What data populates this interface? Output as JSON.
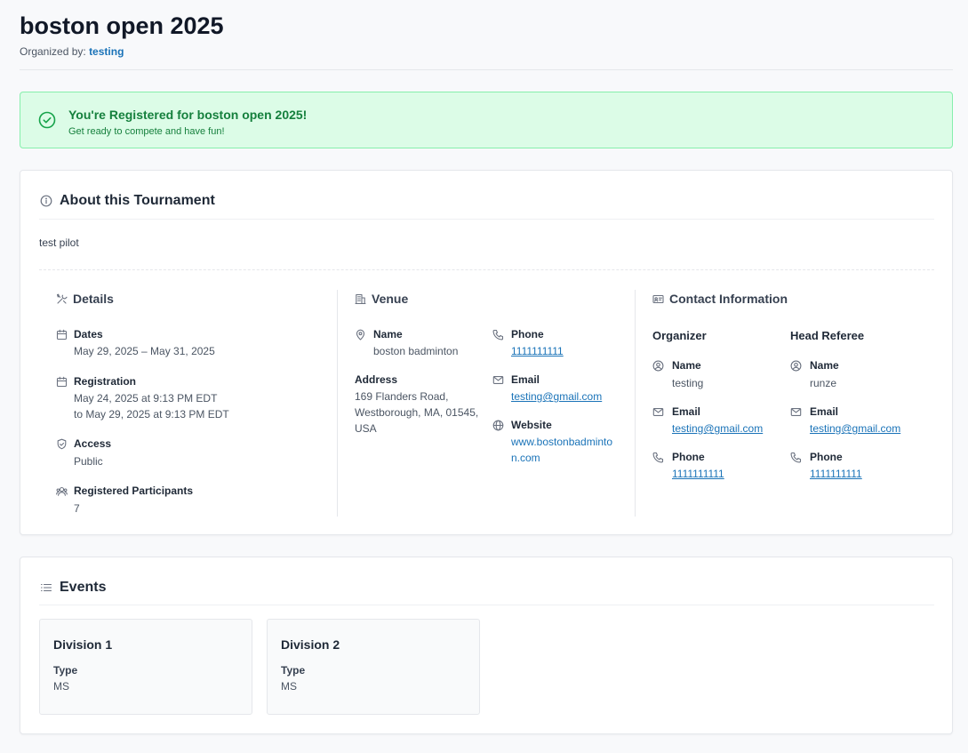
{
  "header": {
    "title": "boston open 2025",
    "organized_label": "Organized by:",
    "organizer_link": "testing"
  },
  "banner": {
    "title": "You're Registered for boston open 2025!",
    "subtitle": "Get ready to compete and have fun!",
    "color": "#15803d"
  },
  "about": {
    "title": "About this Tournament",
    "description": "test pilot",
    "details": {
      "title": "Details",
      "dates_label": "Dates",
      "dates_value": "May 29, 2025 – May 31, 2025",
      "registration_label": "Registration",
      "registration_line1": "May 24, 2025 at 9:13 PM EDT",
      "registration_line2": "to May 29, 2025 at 9:13 PM EDT",
      "access_label": "Access",
      "access_value": "Public",
      "participants_label": "Registered Participants",
      "participants_value": "7"
    },
    "venue": {
      "title": "Venue",
      "name_label": "Name",
      "name_value": "boston badminton",
      "address_label": "Address",
      "address_line1": "169 Flanders Road,",
      "address_line2": "Westborough, MA, 01545,",
      "address_line3": "USA",
      "phone_label": "Phone",
      "phone_value": "1111111111",
      "email_label": "Email",
      "email_value": "testing@gmail.com",
      "website_label": "Website",
      "website_line1": "www.bostonbadminto",
      "website_line2": "n.com"
    },
    "contact": {
      "title": "Contact Information",
      "organizer": {
        "title": "Organizer",
        "name_label": "Name",
        "name_value": "testing",
        "email_label": "Email",
        "email_value": "testing@gmail.com",
        "phone_label": "Phone",
        "phone_value": "1111111111"
      },
      "referee": {
        "title": "Head Referee",
        "name_label": "Name",
        "name_value": "runze",
        "email_label": "Email",
        "email_value": "testing@gmail.com",
        "phone_label": "Phone",
        "phone_value": "1111111111"
      }
    }
  },
  "events": {
    "title": "Events",
    "items": [
      {
        "name": "Division 1",
        "type_label": "Type",
        "type_value": "MS"
      },
      {
        "name": "Division 2",
        "type_label": "Type",
        "type_value": "MS"
      }
    ]
  },
  "colors": {
    "link": "#1a73b8",
    "banner_bg": "#dcfce7",
    "banner_border": "#86efac"
  }
}
